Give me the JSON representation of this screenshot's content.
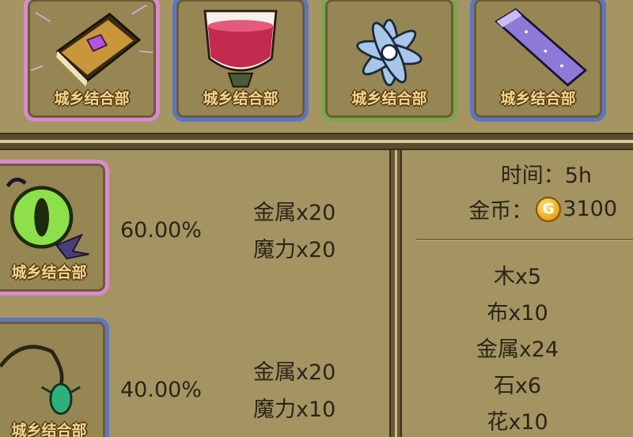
{
  "top_slots": [
    {
      "label": "城乡结合部",
      "item": "spell-book"
    },
    {
      "label": "城乡结合部",
      "item": "red-chalice"
    },
    {
      "label": "城乡结合部",
      "item": "blue-flower"
    },
    {
      "label": "城乡结合部",
      "item": "crystal-bar"
    }
  ],
  "recipes": [
    {
      "slot_label": "城乡结合部",
      "item": "green-eye-charm",
      "rate": "60.00%",
      "requirements": [
        "金属x20",
        "魔力x20"
      ]
    },
    {
      "slot_label": "城乡结合部",
      "item": "beetle-pendant",
      "rate": "40.00%",
      "requirements": [
        "金属x20",
        "魔力x10"
      ]
    }
  ],
  "info": {
    "time_label": "时间：",
    "time_value": "5h",
    "gold_label": "金币：",
    "coin_glyph": "G",
    "gold_value": "3100"
  },
  "outputs": [
    "木x5",
    "布x10",
    "金属x24",
    "石x6",
    "花x10"
  ],
  "colors": {
    "pink_border": "#d98ad0",
    "blue_border": "#5b76c8",
    "green_border": "#77a850",
    "panel_bg": "#a39462",
    "label_gold": "#f0d88b"
  }
}
